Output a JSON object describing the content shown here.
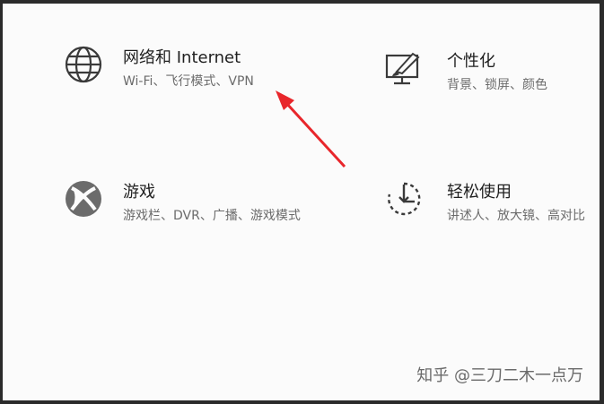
{
  "tiles": [
    {
      "title": "网络和 Internet",
      "desc": "Wi-Fi、飞行模式、VPN",
      "icon": "globe-icon"
    },
    {
      "title": "个性化",
      "desc": "背景、锁屏、颜色",
      "icon": "paint-monitor-icon"
    },
    {
      "title": "游戏",
      "desc": "游戏栏、DVR、广播、游戏模式",
      "icon": "xbox-icon"
    },
    {
      "title": "轻松使用",
      "desc": "讲述人、放大镜、高对比",
      "icon": "ease-of-access-timer-icon"
    }
  ],
  "annotation": {
    "color": "#e8262b"
  },
  "watermark": "知乎 @三刀二木一点万"
}
